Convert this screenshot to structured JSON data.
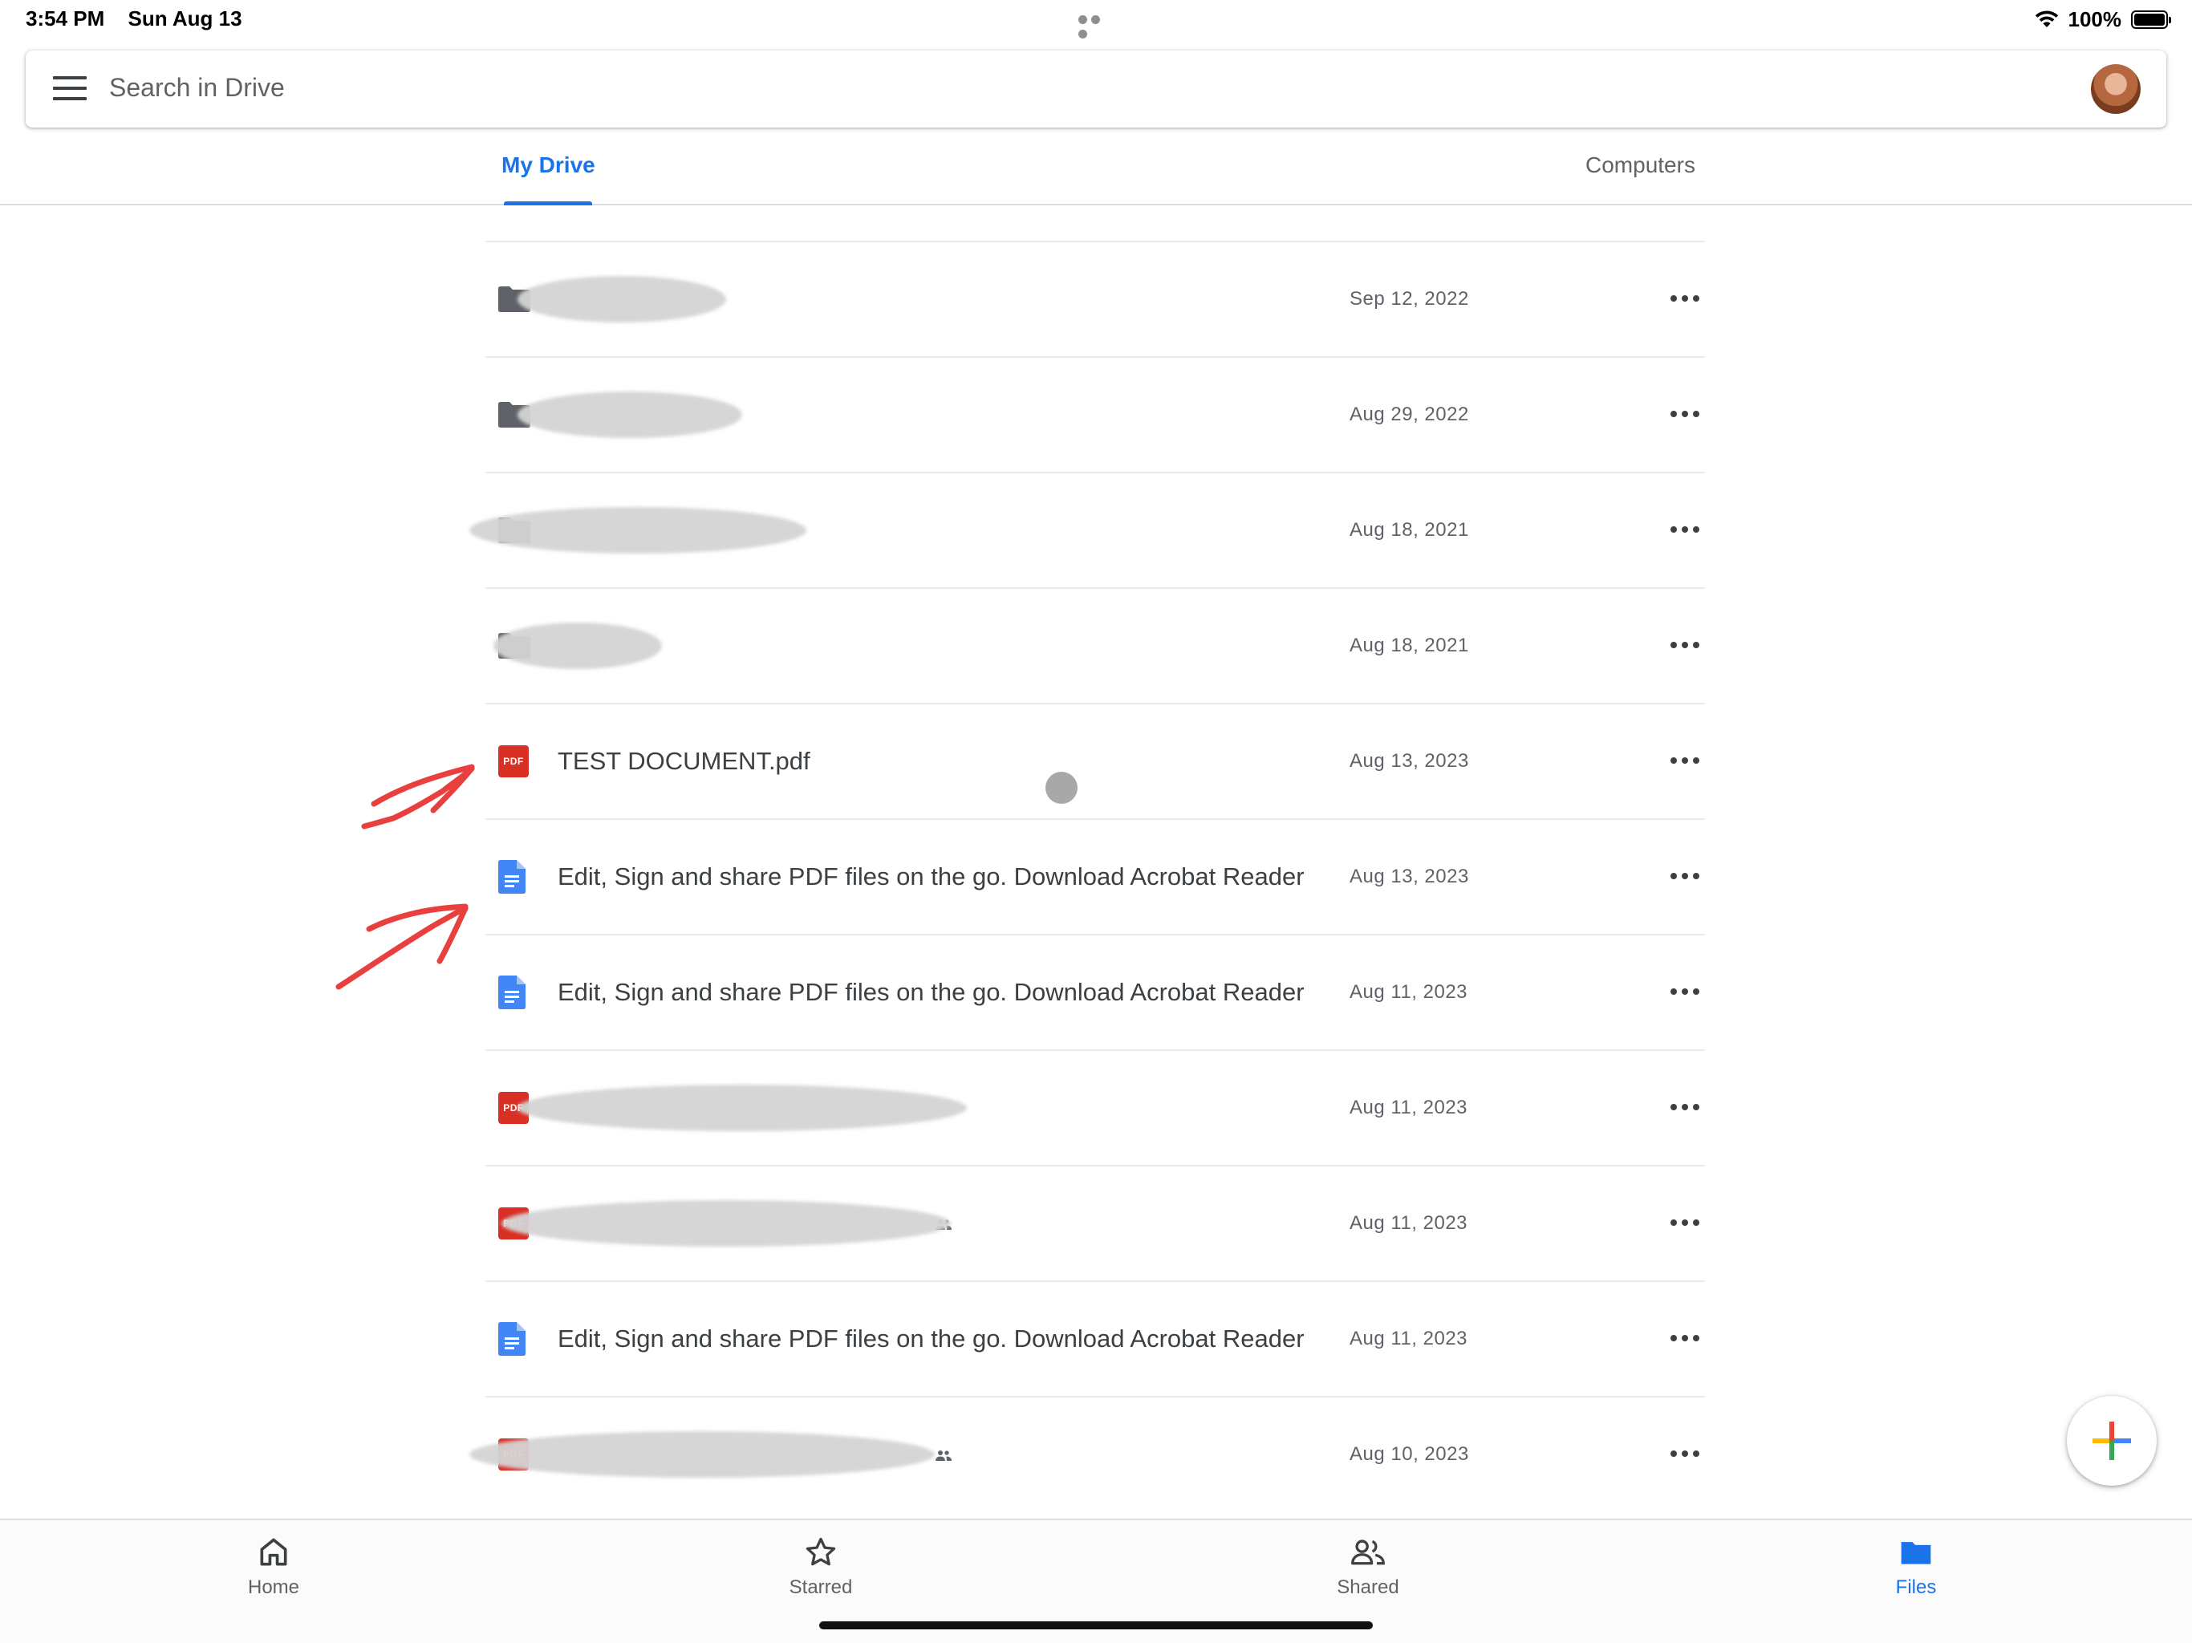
{
  "status_bar": {
    "time": "3:54 PM",
    "date": "Sun Aug 13",
    "battery": "100%"
  },
  "search": {
    "placeholder": "Search in Drive"
  },
  "tabs": [
    {
      "label": "My Drive",
      "active": true
    },
    {
      "label": "Computers",
      "active": false
    }
  ],
  "files": [
    {
      "type": "folder",
      "name": "",
      "redacted": true,
      "date": "Sep 12, 2022"
    },
    {
      "type": "folder",
      "name": "",
      "redacted": true,
      "date": "Aug 29, 2022"
    },
    {
      "type": "folder",
      "name": "",
      "redacted": true,
      "date": "Aug 18, 2021"
    },
    {
      "type": "folder",
      "name": "",
      "redacted": true,
      "date": "Aug 18, 2021"
    },
    {
      "type": "pdf",
      "name": "TEST DOCUMENT.pdf",
      "redacted": false,
      "date": "Aug 13, 2023"
    },
    {
      "type": "doc",
      "name": "Edit, Sign and share PDF files on the go. Download Acrobat Reader",
      "redacted": false,
      "date": "Aug 13, 2023"
    },
    {
      "type": "doc",
      "name": "Edit, Sign and share PDF files on the go. Download Acrobat Reader",
      "redacted": false,
      "date": "Aug 11, 2023"
    },
    {
      "type": "pdf",
      "name": "",
      "redacted": true,
      "date": "Aug 11, 2023"
    },
    {
      "type": "pdf",
      "name": "",
      "redacted": true,
      "shared": true,
      "date": "Aug 11, 2023"
    },
    {
      "type": "doc",
      "name": "Edit, Sign and share PDF files on the go. Download Acrobat Reader",
      "redacted": false,
      "date": "Aug 11, 2023"
    },
    {
      "type": "pdf",
      "name": "",
      "redacted": true,
      "shared": true,
      "date": "Aug 10, 2023"
    }
  ],
  "icons": {
    "pdf_label": "PDF",
    "folder_color": "#5f6368",
    "pdf_color": "#d93025",
    "doc_color": "#4285f4",
    "accent": "#1a73e8"
  },
  "fab": {
    "icon": "plus-icon"
  },
  "bottom_nav": [
    {
      "label": "Home",
      "icon": "home-icon",
      "active": false
    },
    {
      "label": "Starred",
      "icon": "star-icon",
      "active": false
    },
    {
      "label": "Shared",
      "icon": "shared-people-icon",
      "active": false
    },
    {
      "label": "Files",
      "icon": "folder-icon",
      "active": true
    }
  ]
}
